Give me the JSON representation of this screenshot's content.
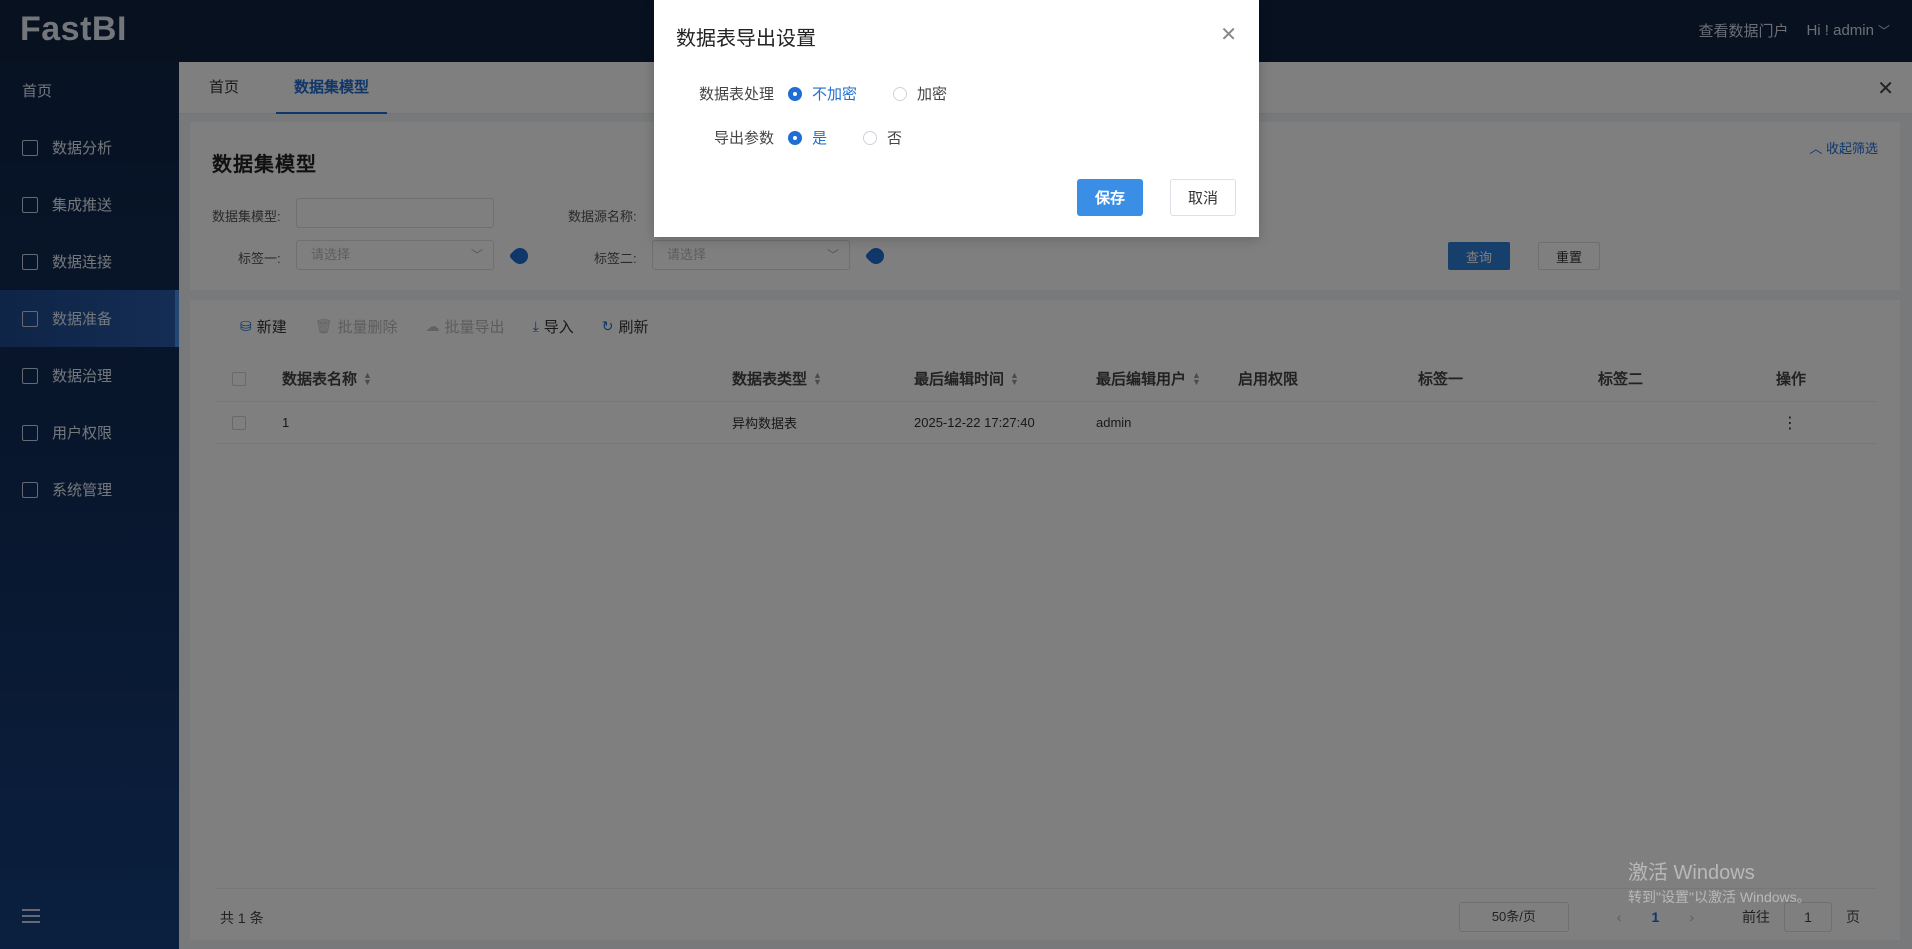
{
  "app": {
    "logo": "FastBI"
  },
  "topbar": {
    "portal_link": "查看数据门户",
    "user_menu": "Hi ! admin"
  },
  "sidebar": {
    "home": "首页",
    "items": [
      {
        "label": "数据分析",
        "icon": "analysis-icon"
      },
      {
        "label": "集成推送",
        "icon": "push-icon"
      },
      {
        "label": "数据连接",
        "icon": "connection-icon"
      },
      {
        "label": "数据准备",
        "icon": "prepare-icon",
        "active": true
      },
      {
        "label": "数据治理",
        "icon": "governance-icon"
      },
      {
        "label": "用户权限",
        "icon": "user-permission-icon"
      },
      {
        "label": "系统管理",
        "icon": "system-icon"
      }
    ]
  },
  "tabs": [
    {
      "label": "首页"
    },
    {
      "label": "数据集模型",
      "active": true
    }
  ],
  "filter": {
    "title": "数据集模型",
    "collapse_label": "收起筛选",
    "dataset_model_label": "数据集模型:",
    "dataset_model_value": "",
    "datasource_label": "数据源名称:",
    "tag1_label": "标签一:",
    "tag1_placeholder": "请选择",
    "tag2_label": "标签二:",
    "tag2_placeholder": "请选择",
    "query_button": "查询",
    "reset_button": "重置"
  },
  "toolbar": {
    "new": "新建",
    "batch_delete": "批量删除",
    "batch_export": "批量导出",
    "import": "导入",
    "refresh": "刷新"
  },
  "table": {
    "columns": [
      "数据表名称",
      "数据表类型",
      "最后编辑时间",
      "最后编辑用户",
      "启用权限",
      "标签一",
      "标签二",
      "操作"
    ],
    "rows": [
      {
        "name": "1",
        "type": "异构数据表",
        "edited_at": "2025-12-22 17:27:40",
        "edited_by": "admin",
        "permission": "",
        "tag1": "",
        "tag2": "",
        "action": "⋮"
      }
    ]
  },
  "pagination": {
    "total": "共 1 条",
    "page_size": "50条/页",
    "current_page": "1",
    "goto_prefix": "前往",
    "goto_value": "1",
    "goto_suffix": "页"
  },
  "dialog": {
    "title": "数据表导出设置",
    "row1_label": "数据表处理",
    "row1_opt1": "不加密",
    "row1_opt2": "加密",
    "row2_label": "导出参数",
    "row2_opt1": "是",
    "row2_opt2": "否",
    "save": "保存",
    "cancel": "取消"
  },
  "watermark": {
    "line1": "激活 Windows",
    "line2": "转到\"设置\"以激活 Windows。"
  },
  "colors": {
    "primary": "#1f6ed4",
    "topbar": "#0f2240",
    "save_button": "#3a8ee6"
  }
}
